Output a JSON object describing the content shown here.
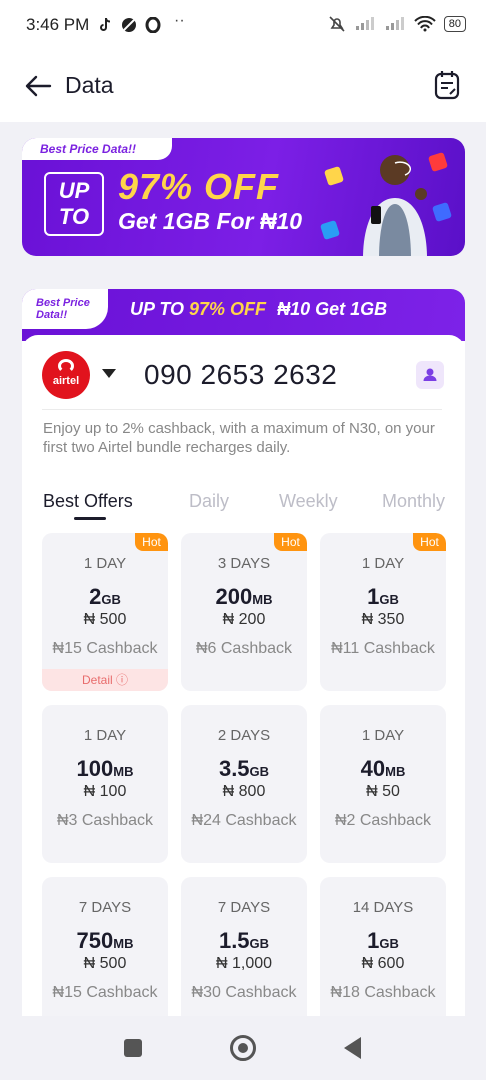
{
  "status_bar": {
    "time": "3:46 PM",
    "battery": "80"
  },
  "header": {
    "title": "Data"
  },
  "banner": {
    "ribbon": "Best Price Data!!",
    "up_to": "UP TO",
    "off": "97% OFF",
    "sub": "Get 1GB For ₦10"
  },
  "strip": {
    "tag": "Best Price Data!!",
    "lead": "UP TO",
    "highlight": "97% OFF",
    "tail": "₦10 Get 1GB"
  },
  "provider": {
    "logo_text": "airtel",
    "phone_number": "090 2653 2632"
  },
  "note": "Enjoy up to 2% cashback, with a maximum of N30, on your first two Airtel bundle recharges daily.",
  "tabs": [
    "Best Offers",
    "Daily",
    "Weekly",
    "Monthly"
  ],
  "offers": [
    {
      "duration": "1 DAY",
      "amount": "2",
      "unit": "GB",
      "price": "₦ 500",
      "cashback": "₦15 Cashback",
      "hot": "Hot",
      "detail": "Detail ⓘ"
    },
    {
      "duration": "3 DAYS",
      "amount": "200",
      "unit": "MB",
      "price": "₦ 200",
      "cashback": "₦6 Cashback",
      "hot": "Hot"
    },
    {
      "duration": "1 DAY",
      "amount": "1",
      "unit": "GB",
      "price": "₦ 350",
      "cashback": "₦11 Cashback",
      "hot": "Hot"
    },
    {
      "duration": "1 DAY",
      "amount": "100",
      "unit": "MB",
      "price": "₦ 100",
      "cashback": "₦3 Cashback"
    },
    {
      "duration": "2 DAYS",
      "amount": "3.5",
      "unit": "GB",
      "price": "₦ 800",
      "cashback": "₦24 Cashback"
    },
    {
      "duration": "1 DAY",
      "amount": "40",
      "unit": "MB",
      "price": "₦ 50",
      "cashback": "₦2 Cashback"
    },
    {
      "duration": "7 DAYS",
      "amount": "750",
      "unit": "MB",
      "price": "₦ 500",
      "cashback": "₦15 Cashback"
    },
    {
      "duration": "7 DAYS",
      "amount": "1.5",
      "unit": "GB",
      "price": "₦ 1,000",
      "cashback": "₦30 Cashback"
    },
    {
      "duration": "14 DAYS",
      "amount": "1",
      "unit": "GB",
      "price": "₦ 600",
      "cashback": "₦18 Cashback"
    }
  ]
}
